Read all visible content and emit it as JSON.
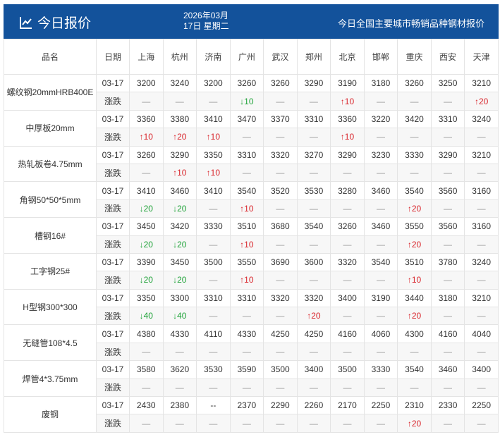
{
  "header": {
    "title": "今日报价",
    "date_line1": "2026年03月",
    "date_line2": "17日 星期二",
    "subtitle": "今日全国主要城市畅销品种钢材报价"
  },
  "columns": [
    "品名",
    "日期",
    "上海",
    "杭州",
    "济南",
    "广州",
    "武汉",
    "郑州",
    "北京",
    "邯郸",
    "重庆",
    "西安",
    "天津"
  ],
  "change_label": "涨跌",
  "colors": {
    "header_bg": "#13529b",
    "up": "#d9262c",
    "down": "#21a33a"
  },
  "rows": [
    {
      "name": "螺纹钢20mmHRB400E",
      "date": "03-17",
      "prices": [
        "3200",
        "3240",
        "3200",
        "3260",
        "3260",
        "3290",
        "3190",
        "3180",
        "3260",
        "3250",
        "3210"
      ],
      "changes": [
        "—",
        "—",
        "—",
        "↓10",
        "—",
        "—",
        "↑10",
        "—",
        "—",
        "—",
        "↑20"
      ]
    },
    {
      "name": "中厚板20mm",
      "date": "03-17",
      "prices": [
        "3360",
        "3380",
        "3410",
        "3470",
        "3370",
        "3310",
        "3360",
        "3220",
        "3420",
        "3310",
        "3240"
      ],
      "changes": [
        "↑10",
        "↑20",
        "↑10",
        "—",
        "—",
        "—",
        "↑10",
        "—",
        "—",
        "—",
        "—"
      ]
    },
    {
      "name": "热轧板卷4.75mm",
      "date": "03-17",
      "prices": [
        "3260",
        "3290",
        "3350",
        "3310",
        "3320",
        "3270",
        "3290",
        "3230",
        "3330",
        "3290",
        "3210"
      ],
      "changes": [
        "—",
        "↑10",
        "↑10",
        "—",
        "—",
        "—",
        "—",
        "—",
        "—",
        "—",
        "—"
      ]
    },
    {
      "name": "角钢50*50*5mm",
      "date": "03-17",
      "prices": [
        "3410",
        "3460",
        "3410",
        "3540",
        "3520",
        "3530",
        "3280",
        "3460",
        "3540",
        "3560",
        "3160"
      ],
      "changes": [
        "↓20",
        "↓20",
        "—",
        "↑10",
        "—",
        "—",
        "—",
        "—",
        "↑20",
        "—",
        "—"
      ]
    },
    {
      "name": "槽钢16#",
      "date": "03-17",
      "prices": [
        "3450",
        "3420",
        "3330",
        "3510",
        "3680",
        "3540",
        "3260",
        "3460",
        "3550",
        "3560",
        "3160"
      ],
      "changes": [
        "↓20",
        "↓20",
        "—",
        "↑10",
        "—",
        "—",
        "—",
        "—",
        "↑20",
        "—",
        "—"
      ]
    },
    {
      "name": "工字钢25#",
      "date": "03-17",
      "prices": [
        "3390",
        "3450",
        "3500",
        "3550",
        "3690",
        "3600",
        "3320",
        "3540",
        "3510",
        "3780",
        "3240"
      ],
      "changes": [
        "↓20",
        "↓20",
        "—",
        "↑10",
        "—",
        "—",
        "—",
        "—",
        "↑10",
        "—",
        "—"
      ]
    },
    {
      "name": "H型钢300*300",
      "date": "03-17",
      "prices": [
        "3350",
        "3300",
        "3310",
        "3310",
        "3320",
        "3320",
        "3400",
        "3190",
        "3440",
        "3180",
        "3210"
      ],
      "changes": [
        "↓40",
        "↓40",
        "—",
        "—",
        "—",
        "↑20",
        "—",
        "—",
        "↑20",
        "—",
        "—"
      ]
    },
    {
      "name": "无缝管108*4.5",
      "date": "03-17",
      "prices": [
        "4380",
        "4330",
        "4110",
        "4330",
        "4250",
        "4250",
        "4160",
        "4060",
        "4300",
        "4160",
        "4040"
      ],
      "changes": [
        "—",
        "—",
        "—",
        "—",
        "—",
        "—",
        "—",
        "—",
        "—",
        "—",
        "—"
      ]
    },
    {
      "name": "焊管4*3.75mm",
      "date": "03-17",
      "prices": [
        "3580",
        "3620",
        "3530",
        "3590",
        "3500",
        "3400",
        "3500",
        "3330",
        "3540",
        "3460",
        "3400"
      ],
      "changes": [
        "—",
        "—",
        "—",
        "—",
        "—",
        "—",
        "—",
        "—",
        "—",
        "—",
        "—"
      ]
    },
    {
      "name": "废钢",
      "date": "03-17",
      "prices": [
        "2430",
        "2380",
        "--",
        "2370",
        "2290",
        "2260",
        "2170",
        "2250",
        "2310",
        "2330",
        "2250"
      ],
      "changes": [
        "—",
        "—",
        "—",
        "—",
        "—",
        "—",
        "—",
        "—",
        "↑20",
        "—",
        "—"
      ]
    }
  ]
}
